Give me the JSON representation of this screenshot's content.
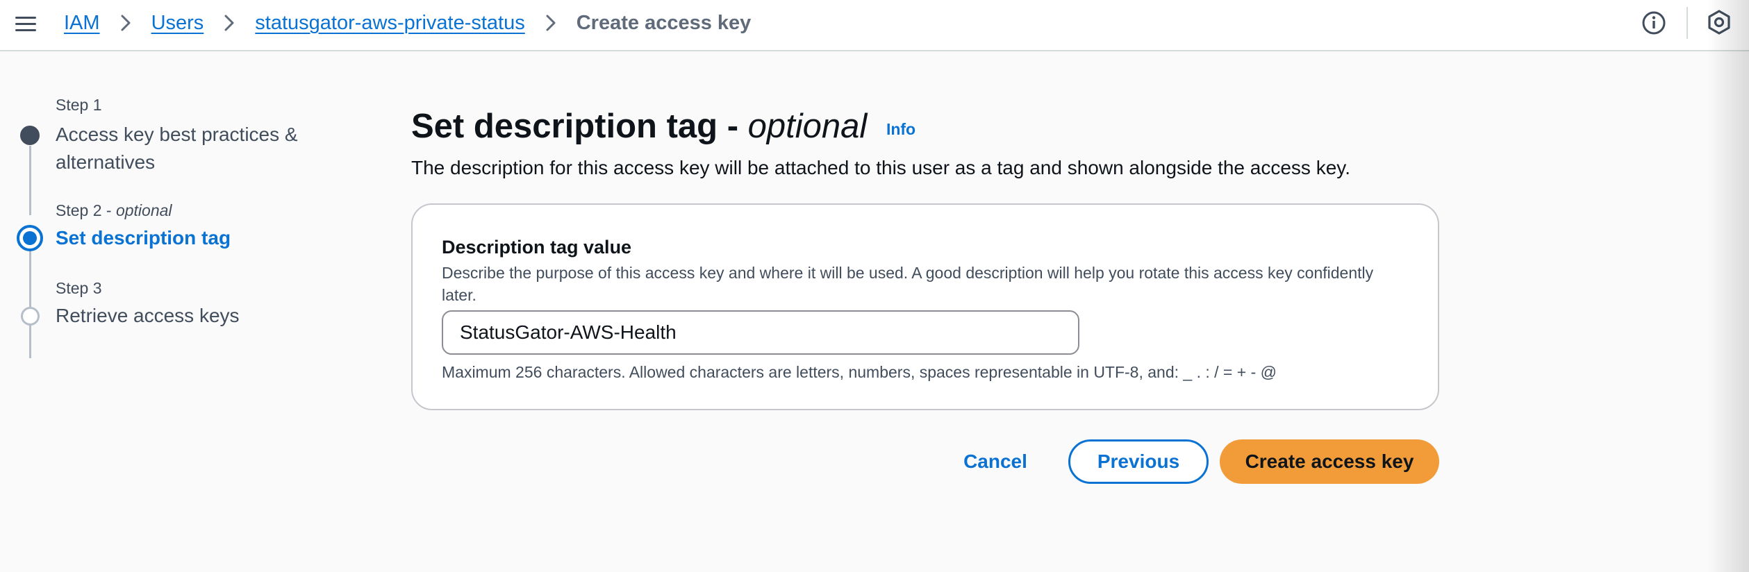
{
  "header": {
    "breadcrumb": [
      "IAM",
      "Users",
      "statusgator-aws-private-status"
    ],
    "current_page": "Create access key",
    "menu_icon": "hamburger-menu-icon",
    "info_icon": "info-circle-icon",
    "settings_icon": "settings-hexagon-icon"
  },
  "steps": [
    {
      "label": "Step 1",
      "title": "Access key best practices & alternatives",
      "state": "completed"
    },
    {
      "label": "Step 2",
      "optional": "optional",
      "title": "Set description tag",
      "state": "active"
    },
    {
      "label": "Step 3",
      "title": "Retrieve access keys",
      "state": "upcoming"
    }
  ],
  "main": {
    "title": "Set description tag",
    "title_separator": "-",
    "title_optional": "optional",
    "info_link": "Info",
    "description": "The description for this access key will be attached to this user as a tag and shown alongside the access key."
  },
  "field": {
    "label": "Description tag value",
    "description": "Describe the purpose of this access key and where it will be used. A good description will help you rotate this access key confidently later.",
    "value": "StatusGator-AWS-Health",
    "constraint": "Maximum 256 characters. Allowed characters are letters, numbers, spaces representable in UTF-8, and: _ . : / = + - @"
  },
  "actions": {
    "cancel": "Cancel",
    "previous": "Previous",
    "create": "Create access key"
  },
  "colors": {
    "link": "#0972d3",
    "primary_button": "#f19c38",
    "text": "#0f141a",
    "secondary_text": "#414d5c"
  }
}
